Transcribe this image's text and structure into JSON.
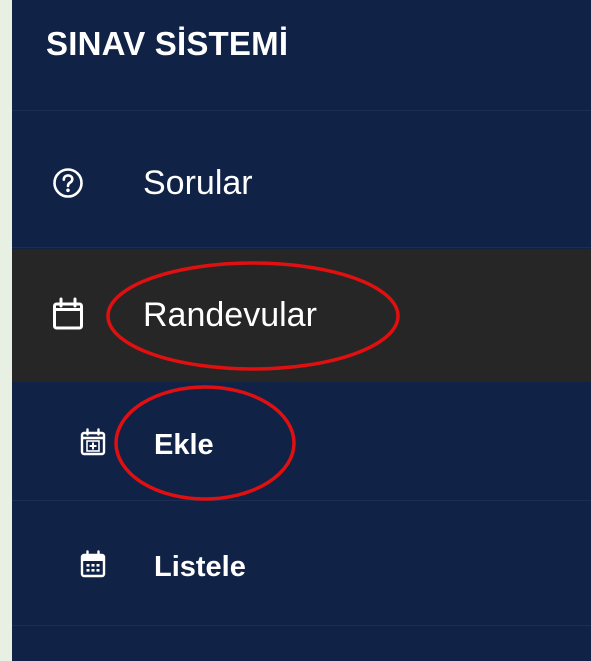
{
  "brand": {
    "title": "SINAV SİSTEMİ"
  },
  "nav": {
    "items": [
      {
        "label": "Sorular",
        "icon": "question-circle-icon"
      },
      {
        "label": "Randevular",
        "icon": "calendar-icon",
        "active": true
      }
    ],
    "subitems": [
      {
        "label": "Ekle",
        "icon": "calendar-plus-icon"
      },
      {
        "label": "Listele",
        "icon": "calendar-grid-icon"
      }
    ]
  },
  "colors": {
    "sidebar_bg": "#112247",
    "active_bg": "#262626",
    "text": "#ffffff",
    "annotation": "#e01010",
    "outer_bg": "#e8f0e3"
  }
}
